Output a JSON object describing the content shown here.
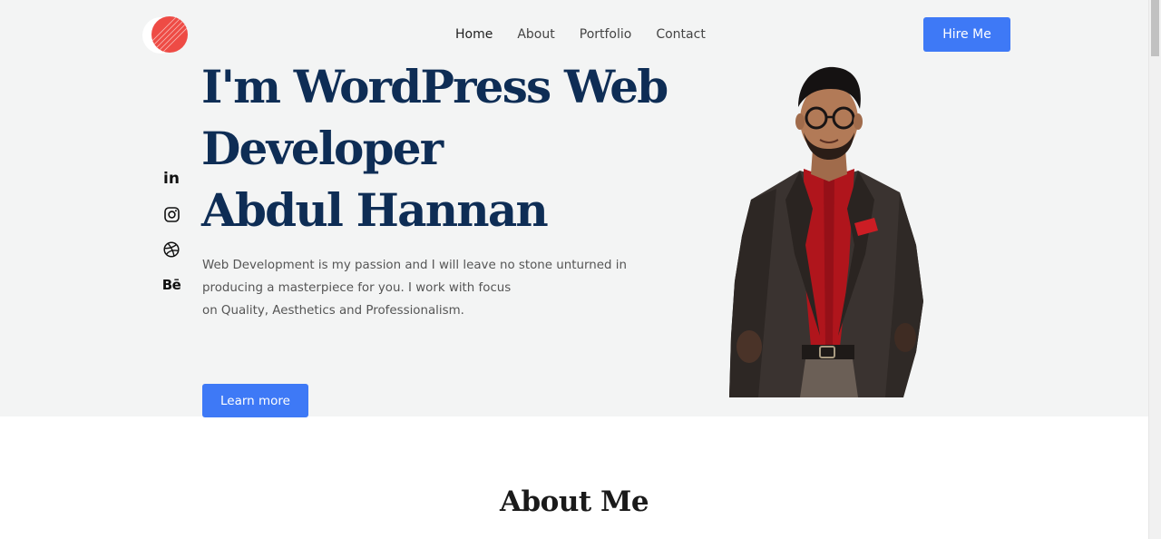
{
  "nav": {
    "items": [
      {
        "label": "Home"
      },
      {
        "label": "About"
      },
      {
        "label": "Portfolio"
      },
      {
        "label": "Contact"
      }
    ],
    "cta_label": "Hire Me"
  },
  "social": [
    {
      "icon": "linkedin-icon",
      "text": "in"
    },
    {
      "icon": "instagram-icon"
    },
    {
      "icon": "dribbble-icon"
    },
    {
      "icon": "behance-icon",
      "text": "Bē"
    }
  ],
  "hero": {
    "title_line1": "I'm WordPress Web",
    "title_line2": "Developer",
    "title_line3": "Abdul Hannan",
    "desc_line1": "Web Development is my passion and I will leave no stone unturned in",
    "desc_line2": "producing a masterpiece for you. I work with focus",
    "desc_line3": "on Quality, Aesthetics and Professionalism.",
    "button_label": "Learn more"
  },
  "about": {
    "title": "About Me"
  },
  "colors": {
    "accent": "#3e79f6",
    "heading": "#0e2d55",
    "hero_bg": "#f3f4f4",
    "logo": "#ee4b45"
  }
}
